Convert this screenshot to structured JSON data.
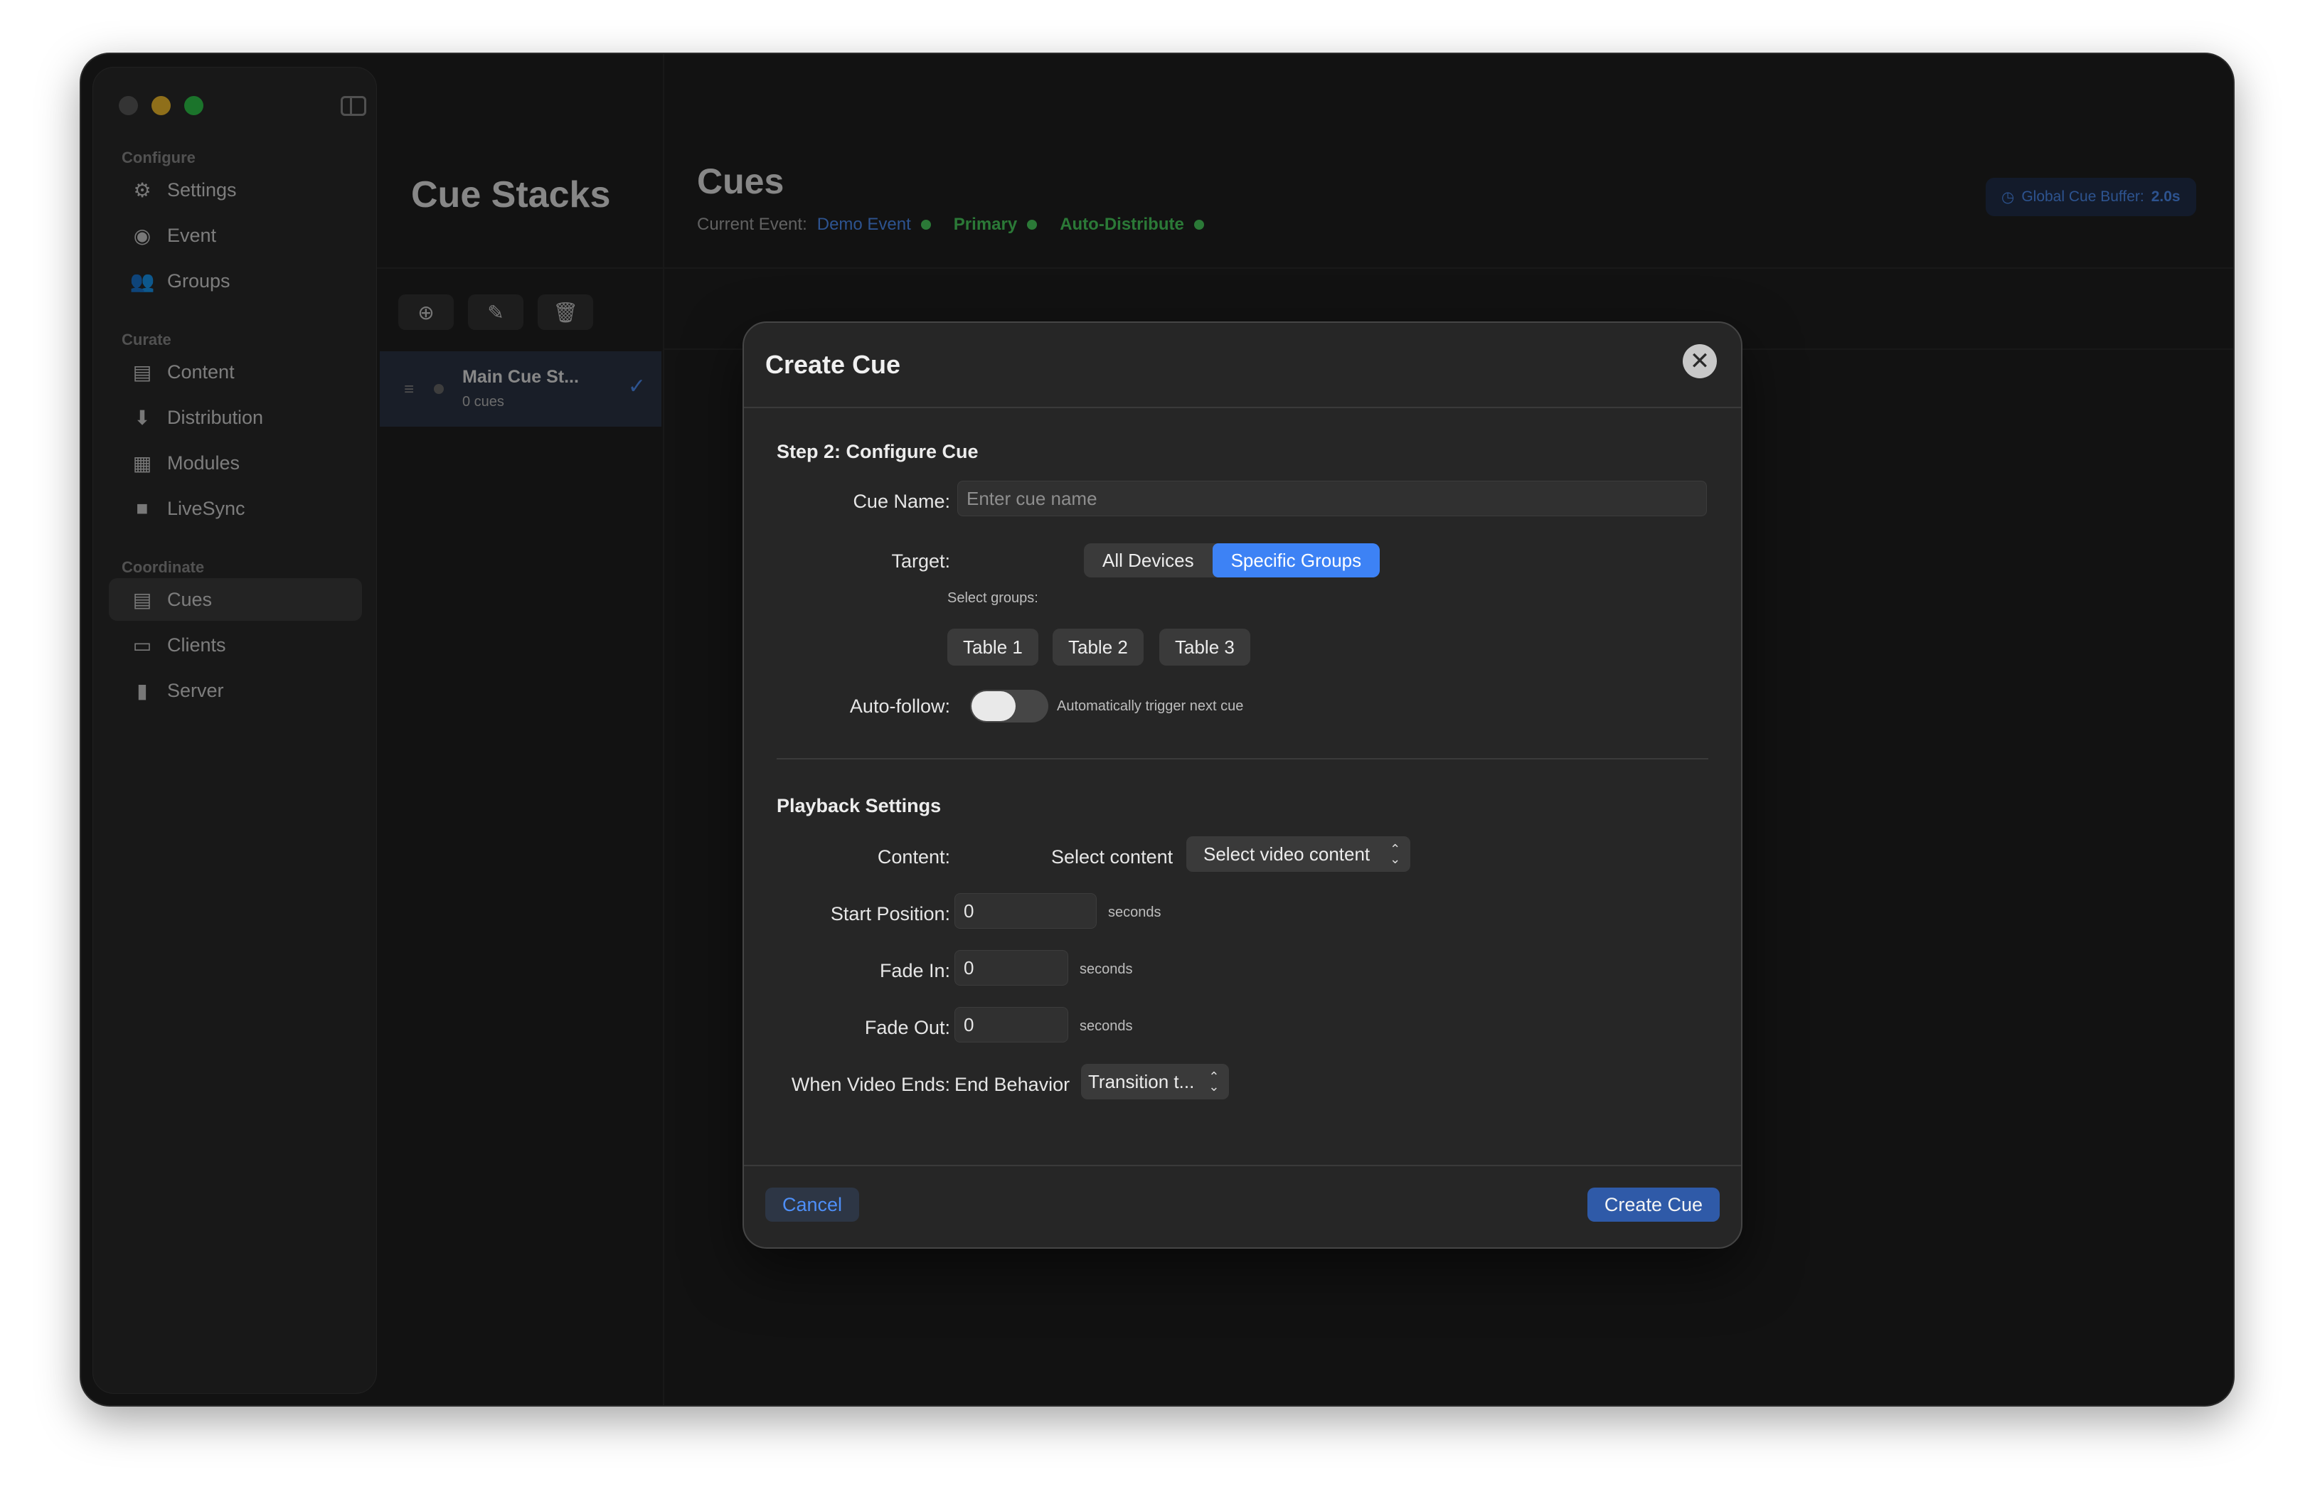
{
  "window": {
    "sidebar_sections": [
      {
        "title": "Configure",
        "items": [
          {
            "label": "Settings",
            "icon": "gear-icon"
          },
          {
            "label": "Event",
            "icon": "event-icon"
          },
          {
            "label": "Groups",
            "icon": "groups-icon"
          }
        ]
      },
      {
        "title": "Curate",
        "items": [
          {
            "label": "Content",
            "icon": "content-icon"
          },
          {
            "label": "Distribution",
            "icon": "distribution-icon"
          },
          {
            "label": "Modules",
            "icon": "modules-icon"
          },
          {
            "label": "LiveSync",
            "icon": "camera-icon"
          }
        ]
      },
      {
        "title": "Coordinate",
        "items": [
          {
            "label": "Cues",
            "icon": "cues-icon",
            "active": true
          },
          {
            "label": "Clients",
            "icon": "clients-icon"
          },
          {
            "label": "Server",
            "icon": "server-icon"
          }
        ]
      }
    ]
  },
  "stacks": {
    "title": "Cue Stacks",
    "toolbar": [
      "add-icon",
      "edit-icon",
      "trash-icon"
    ],
    "items": [
      {
        "name": "Main Cue St...",
        "count": "0 cues",
        "selected": true
      }
    ]
  },
  "cues": {
    "title": "Cues",
    "current_event_label": "Current Event:",
    "event_name": "Demo Event",
    "role": "Primary",
    "mode": "Auto-Distribute",
    "buffer_label": "Global Cue Buffer:",
    "buffer_value": "2.0s"
  },
  "dialog": {
    "title": "Create Cue",
    "step_title": "Step 2: Configure Cue",
    "cue_name_label": "Cue Name:",
    "cue_name_placeholder": "Enter cue name",
    "cue_name_value": "",
    "target_label": "Target:",
    "target_options": [
      "All Devices",
      "Specific Groups"
    ],
    "target_selected": "Specific Groups",
    "select_groups_label": "Select groups:",
    "groups": [
      "Table 1",
      "Table 2",
      "Table 3"
    ],
    "autofollow_label": "Auto-follow:",
    "autofollow_on": false,
    "autofollow_hint": "Automatically trigger next cue",
    "playback_title": "Playback Settings",
    "content_label": "Content:",
    "content_select_label": "Select content",
    "content_select_value": "Select video content",
    "start_label": "Start Position:",
    "start_value": "0",
    "fade_in_label": "Fade In:",
    "fade_in_value": "0",
    "fade_out_label": "Fade Out:",
    "fade_out_value": "0",
    "seconds_unit": "seconds",
    "ends_label": "When Video Ends:",
    "end_behavior_label": "End Behavior",
    "end_behavior_value": "Transition t...",
    "cancel_label": "Cancel",
    "create_label": "Create Cue"
  },
  "colors": {
    "accent": "#3d82f5",
    "status_green": "#4bd15f",
    "window_bg": "#1f1f1f",
    "dialog_bg": "#262626"
  }
}
